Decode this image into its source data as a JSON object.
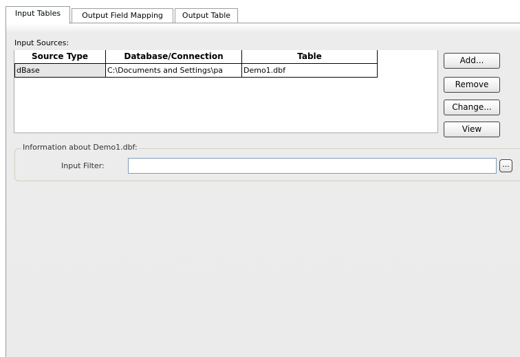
{
  "tabs": [
    {
      "label": "Input Tables",
      "active": true
    },
    {
      "label": "Output Field Mapping",
      "active": false
    },
    {
      "label": "Output Table",
      "active": false
    }
  ],
  "input_sources": {
    "label": "Input Sources:",
    "columns": [
      "Source Type",
      "Database/Connection",
      "Table"
    ],
    "rows": [
      [
        "dBase",
        "C:\\Documents and Settings\\pa",
        "Demo1.dbf"
      ]
    ]
  },
  "buttons": {
    "add": "Add...",
    "remove": "Remove",
    "change": "Change...",
    "view": "View"
  },
  "info_group": {
    "title": "Information about Demo1.dbf:",
    "filter_label": "Input  Filter:",
    "filter_value": "",
    "browse_label": "..."
  }
}
